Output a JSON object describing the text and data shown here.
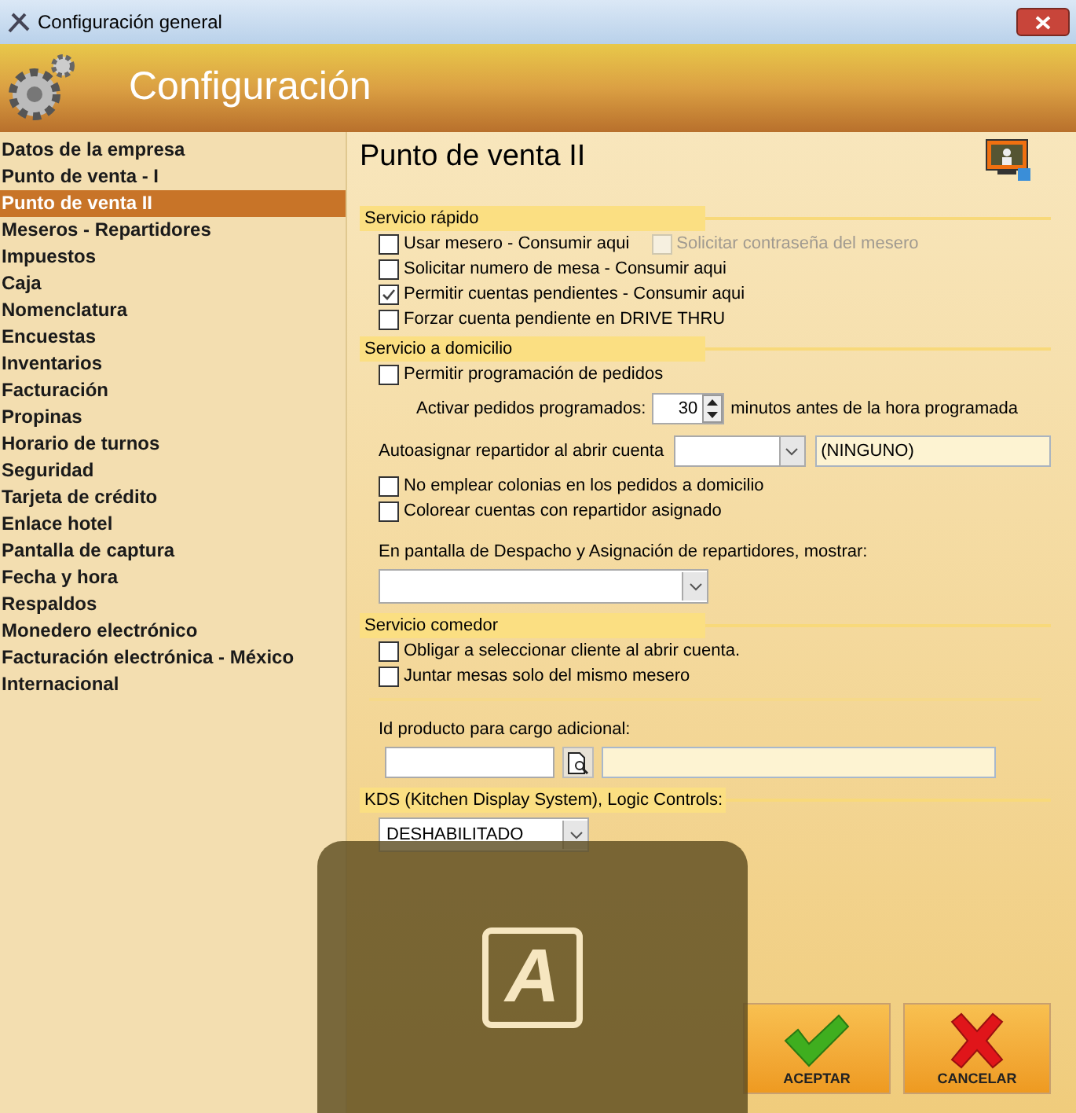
{
  "window": {
    "title": "Configuración general"
  },
  "header": {
    "title": "Configuración"
  },
  "sidebar": {
    "items": [
      {
        "label": "Datos de la empresa",
        "selected": false
      },
      {
        "label": "Punto de venta - I",
        "selected": false
      },
      {
        "label": "Punto de venta II",
        "selected": true
      },
      {
        "label": "Meseros - Repartidores",
        "selected": false
      },
      {
        "label": "Impuestos",
        "selected": false
      },
      {
        "label": "Caja",
        "selected": false
      },
      {
        "label": "Nomenclatura",
        "selected": false
      },
      {
        "label": "Encuestas",
        "selected": false
      },
      {
        "label": "Inventarios",
        "selected": false
      },
      {
        "label": "Facturación",
        "selected": false
      },
      {
        "label": "Propinas",
        "selected": false
      },
      {
        "label": "Horario de turnos",
        "selected": false
      },
      {
        "label": "Seguridad",
        "selected": false
      },
      {
        "label": "Tarjeta de crédito",
        "selected": false
      },
      {
        "label": "Enlace hotel",
        "selected": false
      },
      {
        "label": "Pantalla de captura",
        "selected": false
      },
      {
        "label": "Fecha y hora",
        "selected": false
      },
      {
        "label": "Respaldos",
        "selected": false
      },
      {
        "label": "Monedero electrónico",
        "selected": false
      },
      {
        "label": "Facturación electrónica - México",
        "selected": false
      },
      {
        "label": "Internacional",
        "selected": false
      }
    ]
  },
  "page": {
    "title": "Punto de venta II"
  },
  "rows": [
    {
      "kind": "heading",
      "text": "Servicio rápido"
    },
    {
      "kind": "checkbox_pair",
      "items": [
        {
          "label": "Usar mesero - Consumir aqui",
          "checked": false,
          "disabled": false
        },
        {
          "label": "Solicitar contraseña del mesero",
          "checked": false,
          "disabled": true
        }
      ]
    },
    {
      "kind": "checkbox",
      "label": "Solicitar numero de mesa - Consumir aqui",
      "checked": false
    },
    {
      "kind": "checkbox",
      "label": "Permitir cuentas pendientes - Consumir aqui",
      "checked": true
    },
    {
      "kind": "checkbox",
      "label": "Forzar cuenta pendiente en DRIVE THRU",
      "checked": false
    },
    {
      "kind": "heading",
      "text": "Servicio a domicilio"
    },
    {
      "kind": "checkbox",
      "label": "Permitir programación de pedidos",
      "checked": false
    },
    {
      "kind": "spinner",
      "label": "Activar pedidos programados:",
      "value": "30",
      "suffix": "minutos antes de la hora programada"
    },
    {
      "kind": "combo_field",
      "label": "Autoasignar repartidor al abrir cuenta",
      "field": "(NINGUNO)"
    },
    {
      "kind": "checkbox",
      "label": "No emplear colonias en los pedidos a domicilio",
      "checked": false
    },
    {
      "kind": "checkbox",
      "label": "Colorear cuentas con repartidor asignado",
      "checked": false
    },
    {
      "kind": "label",
      "text": "En pantalla de Despacho y Asignación de repartidores, mostrar:"
    },
    {
      "kind": "dropdown"
    },
    {
      "kind": "heading",
      "text": "Servicio comedor"
    },
    {
      "kind": "checkbox",
      "label": "Obligar a seleccionar cliente al abrir cuenta.",
      "checked": false
    },
    {
      "kind": "checkbox",
      "label": "Juntar mesas solo del mismo mesero",
      "checked": false
    },
    {
      "kind": "rule"
    },
    {
      "kind": "label",
      "text": "Id producto para cargo adicional:"
    },
    {
      "kind": "lookup"
    },
    {
      "kind": "heading",
      "text": "KDS (Kitchen Display System), Logic Controls:"
    },
    {
      "kind": "dropdown",
      "value": "DESHABILITADO"
    }
  ],
  "buttons": [
    {
      "kind": "accept",
      "label": "ACEPTAR"
    },
    {
      "kind": "cancel",
      "label": "CANCELAR"
    }
  ],
  "overlay": {
    "icon_text": "A"
  }
}
